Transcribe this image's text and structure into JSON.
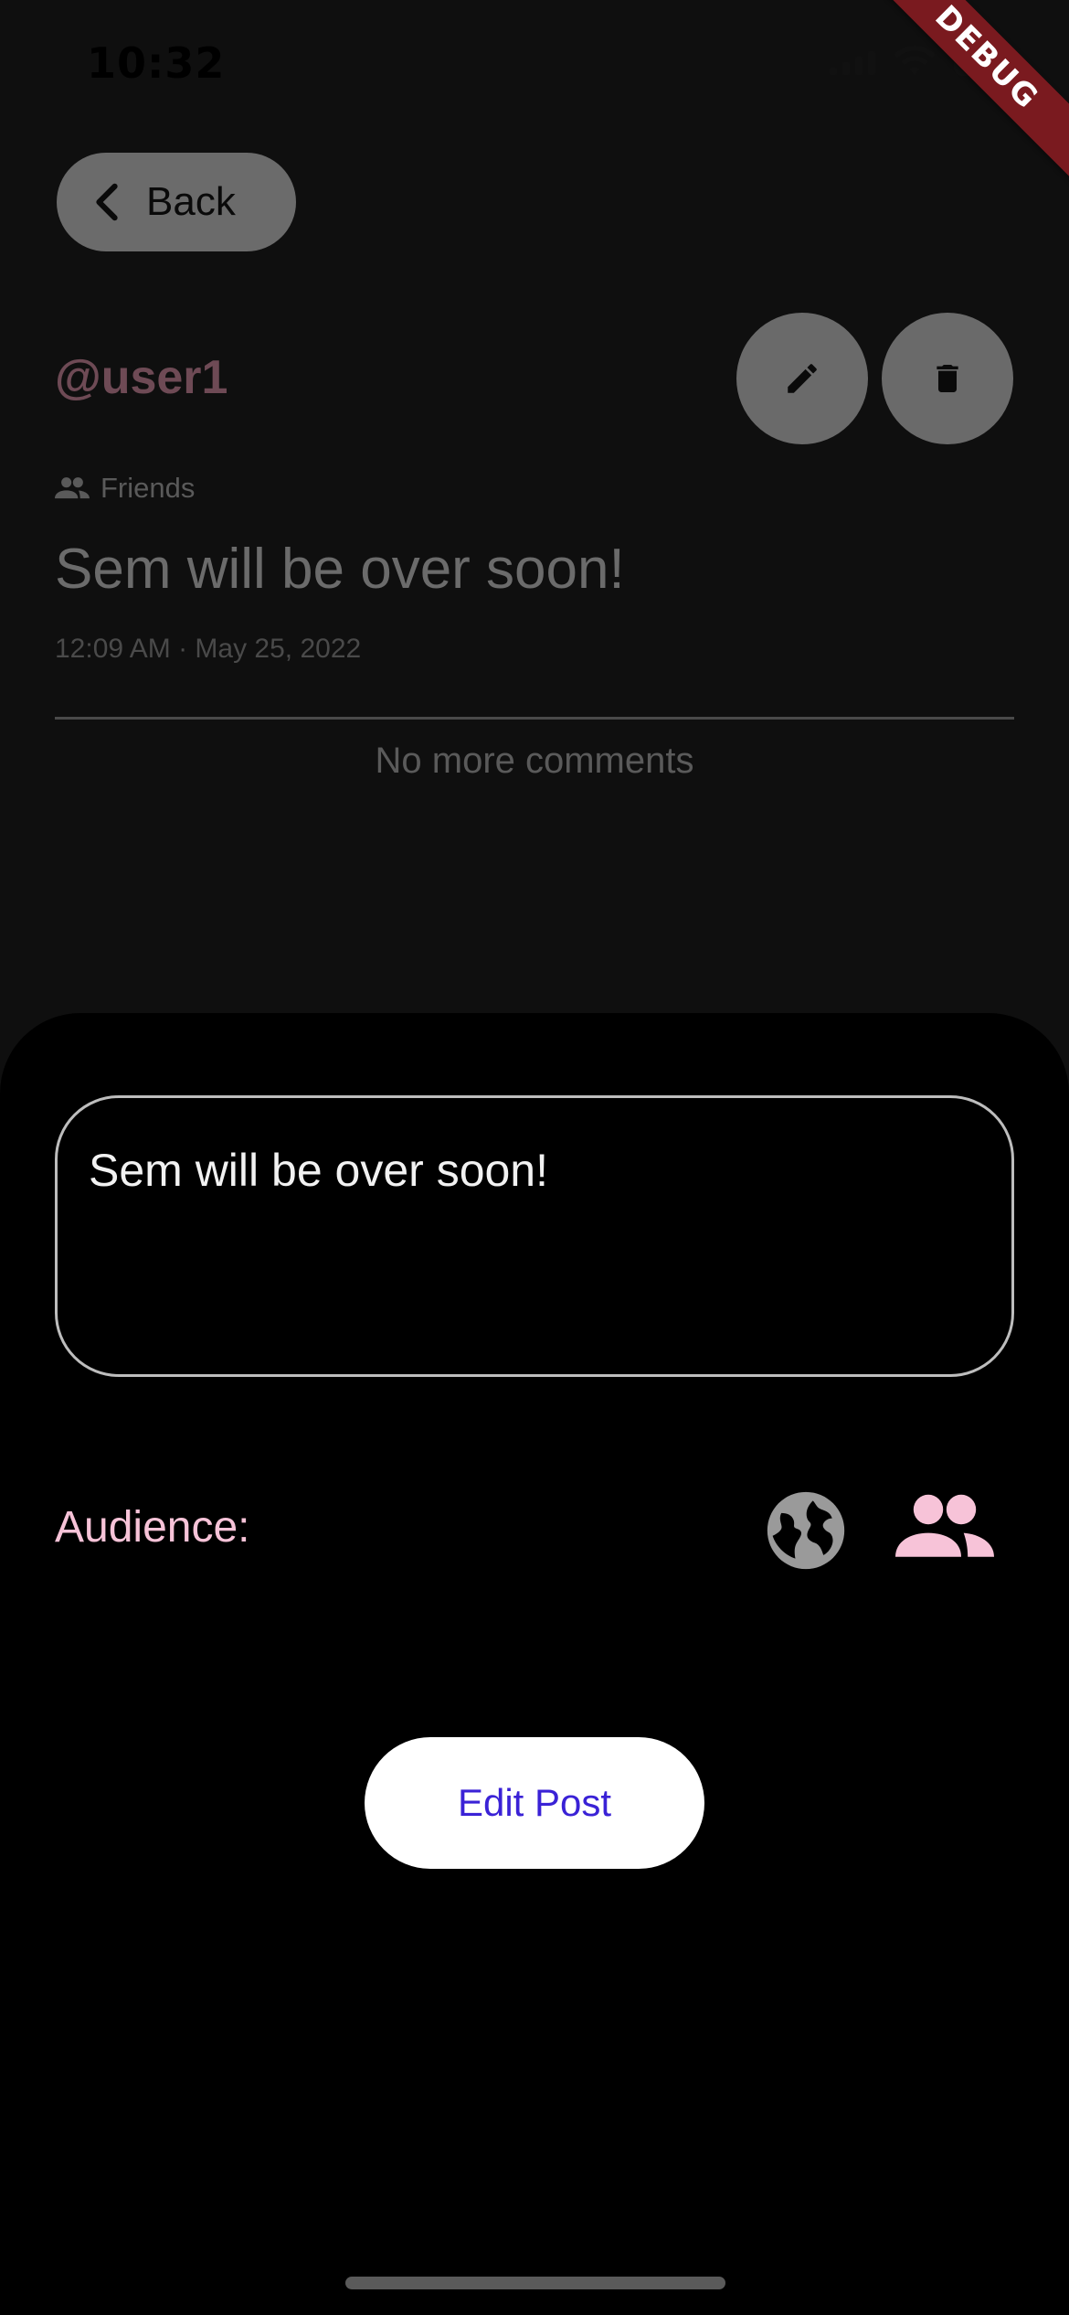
{
  "status_bar": {
    "time": "10:32",
    "debug_label": "DEBUG"
  },
  "header": {
    "back_label": "Back"
  },
  "post": {
    "username": "@user1",
    "audience": "Friends",
    "text": "Sem will be over soon!",
    "timestamp": "12:09 AM · May 25, 2022",
    "comments_status": "No more comments"
  },
  "edit_sheet": {
    "field_value": "Sem will be over soon!",
    "audience_label": "Audience:",
    "audience_options": [
      "globe-icon",
      "people-icon"
    ],
    "selected_audience": "people-icon",
    "submit_label": "Edit Post"
  },
  "colors": {
    "accent_pink": "#f7c3d8",
    "button_text": "#3a22d6",
    "username": "#6e4a55",
    "debug_banner": "#7a1a1f"
  }
}
